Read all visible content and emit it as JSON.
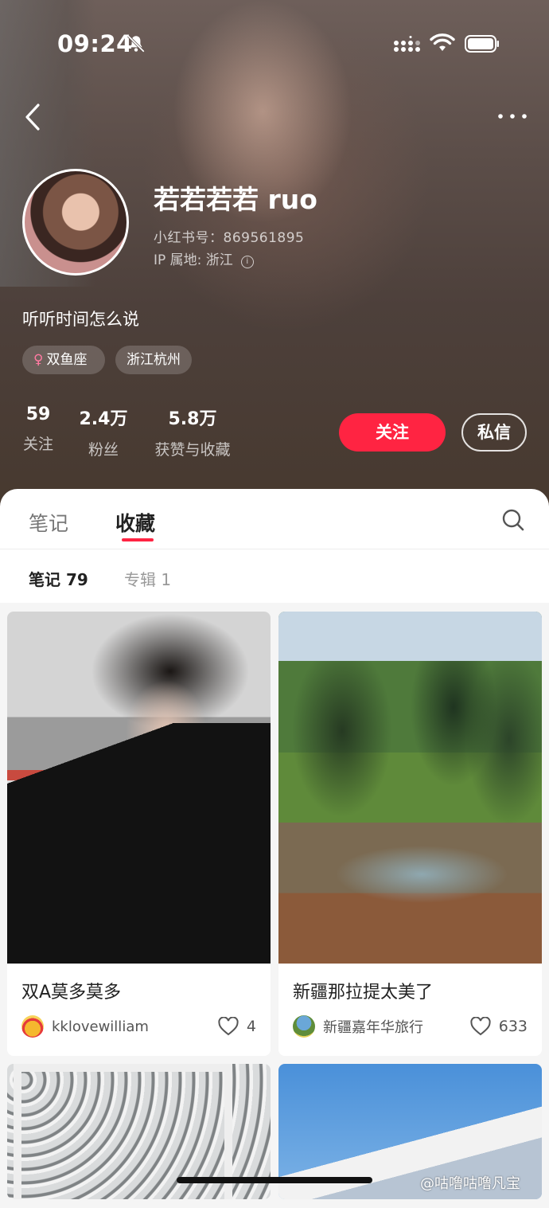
{
  "status_bar": {
    "time": "09:24"
  },
  "profile": {
    "name": "若若若若 ruo",
    "red_id": "小红书号：869561895",
    "ip_location": "IP 属地: 浙江",
    "bio": "听听时间怎么说",
    "tags": [
      "双鱼座",
      "浙江杭州"
    ]
  },
  "stats": [
    {
      "value": "59",
      "label": "关注"
    },
    {
      "value": "2.4万",
      "label": "粉丝"
    },
    {
      "value": "5.8万",
      "label": "获赞与收藏"
    }
  ],
  "actions": {
    "follow": "关注",
    "message": "私信"
  },
  "tabs": {
    "notes": "笔记",
    "favorites": "收藏"
  },
  "subtabs": {
    "notes": "笔记 79",
    "albums": "专辑 1"
  },
  "cards": [
    {
      "title": "双A莫多莫多",
      "user": "kklovewilliam",
      "likes": "4"
    },
    {
      "title": "新疆那拉提太美了",
      "user": "新疆嘉年华旅行",
      "likes": "633"
    }
  ],
  "watermark": "@咕噜咕噜凡宝",
  "colors": {
    "accent": "#ff2442"
  }
}
